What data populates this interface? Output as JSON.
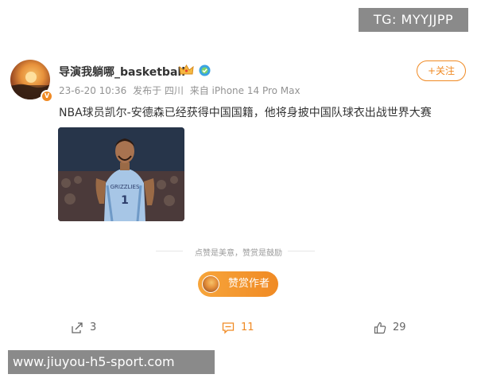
{
  "watermarks": {
    "top": "TG: MYYJJPP",
    "bottom": "www.jiuyou-h5-sport.com"
  },
  "post": {
    "author": {
      "name": "导演我躺哪_basketball",
      "avatar_badge": "V"
    },
    "meta": {
      "time": "23-6-20 10:36",
      "location": "发布于 四川",
      "device": "来自 iPhone 14 Pro Max"
    },
    "follow_label": "+关注",
    "text": "NBA球员凯尔-安德森已经获得中国国籍，他将身披中国队球衣出战世界大赛",
    "image": {
      "jersey_text": "GRIZZLIES",
      "jersey_number": "1"
    }
  },
  "reward": {
    "divider_text": "点赞是美意，赞赏是鼓励",
    "button_label": "赞赏作者"
  },
  "actions": {
    "share_count": "3",
    "comment_count": "11",
    "like_count": "29"
  },
  "colors": {
    "accent": "#f08a24",
    "muted": "#939393",
    "text": "#333333"
  },
  "icons": [
    "crown-icon",
    "verified-icon",
    "share-icon",
    "comment-icon",
    "like-icon"
  ]
}
